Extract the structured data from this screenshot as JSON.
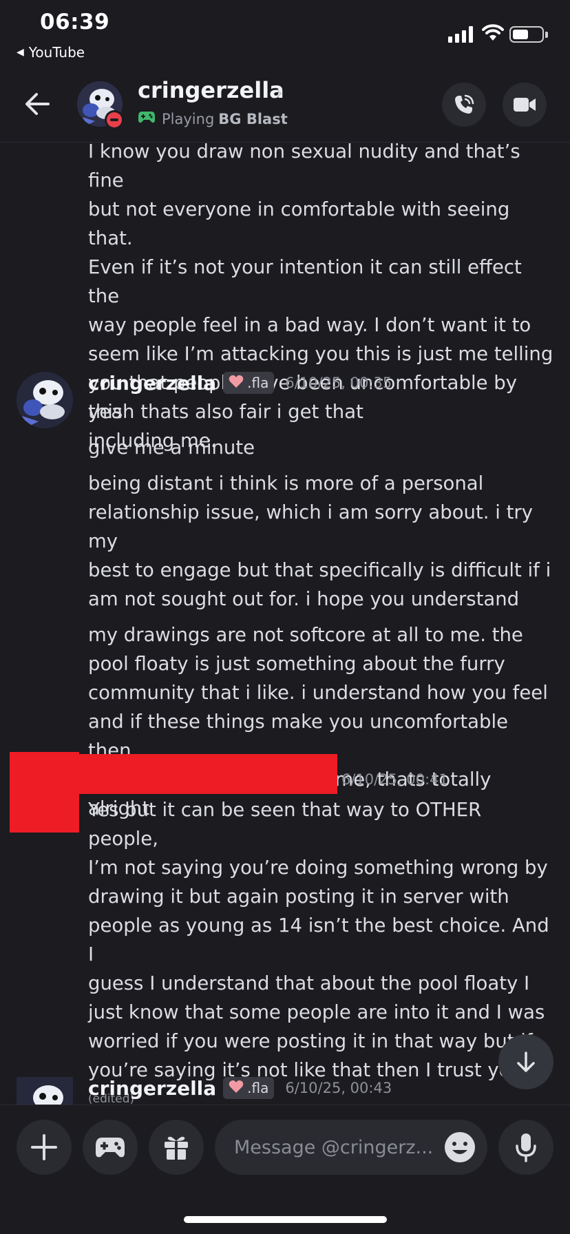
{
  "status_bar": {
    "time": "06:39",
    "back_app": "YouTube",
    "icons": [
      "signal-icon",
      "wifi-icon",
      "battery-icon"
    ]
  },
  "header": {
    "name": "cringerzella",
    "chevron": "›",
    "activity_prefix": "Playing",
    "activity_game": "BG Blast",
    "status_color": "#e8404a",
    "game_icon_color": "#3fb86b"
  },
  "messages": [
    {
      "author": "",
      "time": "",
      "lines": [
        "I know you draw non sexual nudity and that’s fine",
        "but not everyone in comfortable with seeing that.",
        "Even if it’s not your intention it can still effect the",
        "way people feel in a bad way. I don’t want it to",
        "seem like I’m attacking you this is just me telling",
        "you that people have been uncomfortable by this",
        "including me."
      ]
    },
    {
      "author": "cringerzella",
      "tag": ".fla",
      "time": "6/10/25, 00:35",
      "paragraphs": [
        [
          "yeah thats also fair i get that"
        ],
        [
          "give me a minute"
        ],
        [
          "being distant i think is more of a personal",
          "relationship issue, which i am sorry about. i try my",
          "best to engage but that specifically is difficult if i",
          "am not sought out for. i hope you understand"
        ],
        [
          "my drawings are not softcore at all to me. the",
          "pool floaty is just something about the furry",
          "community that i like. i understand how you feel",
          "and if these things make you uncomfortable then",
          "you do not have to follow me, thats totally alright"
        ]
      ]
    },
    {
      "author": "",
      "time": "6/10/25, 00:41",
      "lines": [
        "Yes but it can be seen that way to OTHER people,",
        "I’m not saying you’re doing something wrong by",
        "drawing it but again posting it in server with",
        "people as young as 14 isn’t the best choice. And I",
        "guess I understand that about the pool floaty I",
        "just know that some people are into it and I was",
        "worried if you were posting it in that way but if",
        "you’re saying it’s not like that then I trust you."
      ],
      "edited": "(edited)"
    },
    {
      "author": "cringerzella",
      "tag": ".fla",
      "time": "6/10/25, 00:43"
    }
  ],
  "composer": {
    "placeholder": "Message @cringerz..."
  },
  "colors": {
    "background": "#1b1b20",
    "redaction": "#ee1c25",
    "button_bg": "#2a2b31"
  }
}
